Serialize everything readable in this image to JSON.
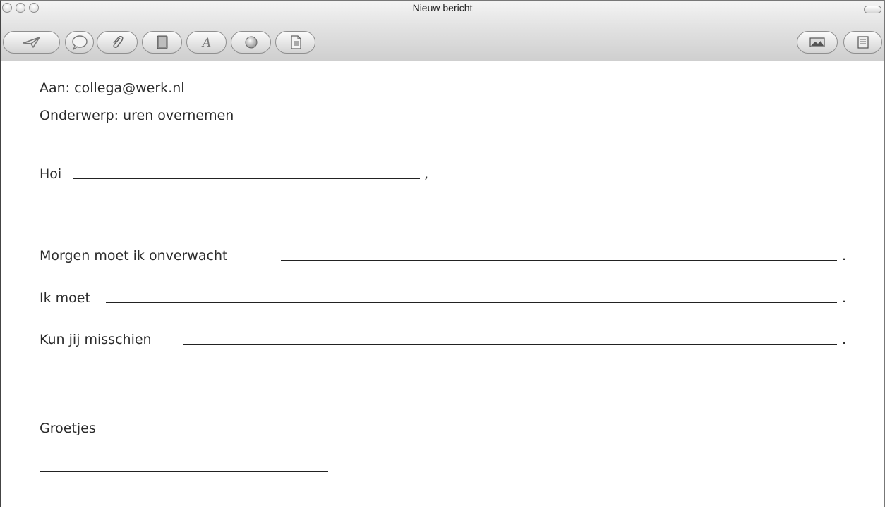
{
  "window": {
    "title": "Nieuw bericht"
  },
  "toolbar": {
    "left_buttons": [
      "send-icon",
      "chat-icon",
      "attach-icon",
      "address-book-icon",
      "fonts-icon",
      "colors-icon",
      "stationery-icon"
    ],
    "right_buttons": [
      "photo-browser-icon",
      "stationery-panel-icon"
    ]
  },
  "mail": {
    "to": "Aan: collega@werk.nl",
    "subject": "Onderwerp: uren overnemen",
    "greeting": "Hoi",
    "greeting_end": ",",
    "line1": "Morgen moet ik onverwacht",
    "line1_end": ".",
    "line2": "Ik moet",
    "line2_end": ".",
    "line3": "Kun jij misschien",
    "line3_end": ".",
    "closing": "Groetjes"
  }
}
